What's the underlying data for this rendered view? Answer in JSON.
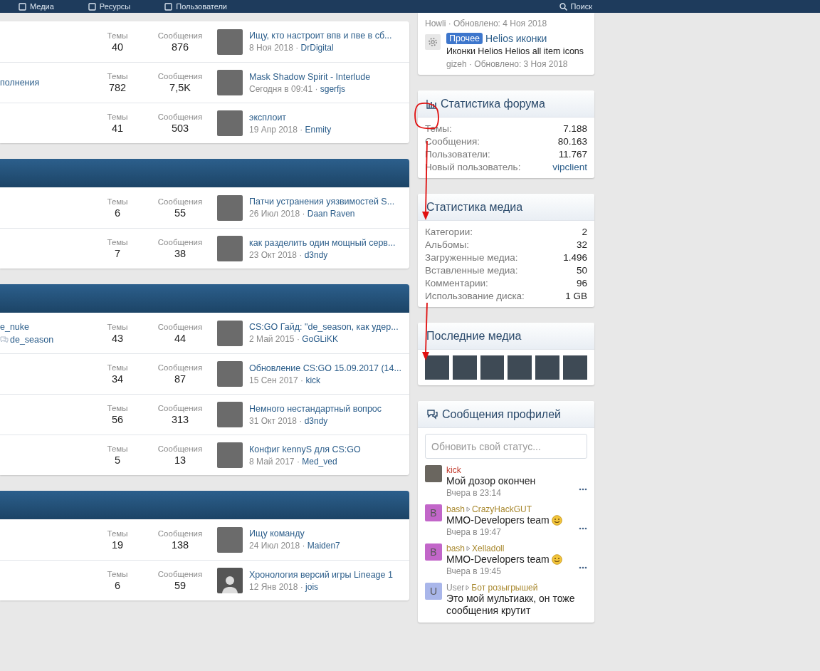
{
  "nav": {
    "items": [
      {
        "label": "Медиа"
      },
      {
        "label": "Ресурсы"
      },
      {
        "label": "Пользователи"
      }
    ],
    "search": "Поиск"
  },
  "sections": [
    {
      "header": false,
      "rows": [
        {
          "threads_label": "Темы",
          "threads": "40",
          "posts_label": "Сообщения",
          "posts": "876",
          "last_title": "Ищу, кто настроит впв и пве в сб...",
          "last_date": "8 Ноя 2018",
          "separator": "·",
          "last_user": "DrDigital",
          "default_avatar": false
        },
        {
          "fragment": "полнения",
          "threads_label": "Темы",
          "threads": "782",
          "posts_label": "Сообщения",
          "posts": "7,5K",
          "last_title": "Mask Shadow Spirit - Interlude",
          "last_date": "Сегодня в 09:41",
          "separator": "·",
          "last_user": "sgerfjs",
          "default_avatar": false
        },
        {
          "threads_label": "Темы",
          "threads": "41",
          "posts_label": "Сообщения",
          "posts": "503",
          "last_title": "эксплоит",
          "last_date": "19 Апр 2018",
          "separator": "·",
          "last_user": "Enmity",
          "default_avatar": false
        }
      ]
    },
    {
      "header": true,
      "rows": [
        {
          "threads_label": "Темы",
          "threads": "6",
          "posts_label": "Сообщения",
          "posts": "55",
          "last_title": "Патчи устранения уязвимостей S...",
          "last_date": "26 Июл 2018",
          "separator": "·",
          "last_user": "Daan Raven",
          "default_avatar": false
        },
        {
          "threads_label": "Темы",
          "threads": "7",
          "posts_label": "Сообщения",
          "posts": "38",
          "last_title": "как разделить один мощный серв...",
          "last_date": "23 Окт 2018",
          "separator": "·",
          "last_user": "d3ndy",
          "default_avatar": false
        }
      ]
    },
    {
      "header": true,
      "rows": [
        {
          "subforums": [
            {
              "label": "e_nuke",
              "icon": false
            },
            {
              "label": "de_season",
              "icon": true
            }
          ],
          "threads_label": "Темы",
          "threads": "43",
          "posts_label": "Сообщения",
          "posts": "44",
          "last_title": "CS:GO Гайд: \"de_season, как удер...",
          "last_date": "2 Май 2015",
          "separator": "·",
          "last_user": "GoGLiKK",
          "default_avatar": false
        },
        {
          "threads_label": "Темы",
          "threads": "34",
          "posts_label": "Сообщения",
          "posts": "87",
          "last_title": "Обновление CS:GO 15.09.2017 (14...",
          "last_date": "15 Сен 2017",
          "separator": "·",
          "last_user": "kick",
          "default_avatar": false
        },
        {
          "threads_label": "Темы",
          "threads": "56",
          "posts_label": "Сообщения",
          "posts": "313",
          "last_title": "Немного нестандартный вопрос",
          "last_date": "31 Окт 2018",
          "separator": "·",
          "last_user": "d3ndy",
          "default_avatar": false
        },
        {
          "threads_label": "Темы",
          "threads": "5",
          "posts_label": "Сообщения",
          "posts": "13",
          "last_title": "Конфиг kennyS для CS:GO",
          "last_date": "8 Май 2017",
          "separator": "·",
          "last_user": "Med_ved",
          "default_avatar": false
        }
      ]
    },
    {
      "header": true,
      "rows": [
        {
          "threads_label": "Темы",
          "threads": "19",
          "posts_label": "Сообщения",
          "posts": "138",
          "last_title": "Ищу команду",
          "last_date": "24 Июл 2018",
          "separator": "·",
          "last_user": "Maiden7",
          "default_avatar": false
        },
        {
          "threads_label": "Темы",
          "threads": "6",
          "posts_label": "Сообщения",
          "posts": "59",
          "last_title": "Хронология версий игры Lineage 1",
          "last_date": "12 Янв 2018",
          "separator": "·",
          "last_user": "jois",
          "default_avatar": true
        }
      ]
    }
  ],
  "resources": {
    "items": [
      {
        "meta": "Howli · Обновлено: 4 Ноя 2018"
      },
      {
        "badge": "Прочее",
        "title": "Helios иконки",
        "description": "Иконки Helios Helios all item icons",
        "meta": "gizeh · Обновлено: 3 Ноя 2018"
      }
    ]
  },
  "forum_stats": {
    "title": "Статистика форума",
    "rows": [
      {
        "label": "Темы:",
        "value": "7.188",
        "kind": "text"
      },
      {
        "label": "Сообщения:",
        "value": "80.163",
        "kind": "text"
      },
      {
        "label": "Пользователи:",
        "value": "11.767",
        "kind": "text"
      },
      {
        "label": "Новый пользователь:",
        "value": "vipclient",
        "kind": "link"
      }
    ]
  },
  "media_stats": {
    "title": "Статистика медиа",
    "rows": [
      {
        "label": "Категории:",
        "value": "2",
        "kind": "text"
      },
      {
        "label": "Альбомы:",
        "value": "32",
        "kind": "text"
      },
      {
        "label": "Загруженные медиа:",
        "value": "1.496",
        "kind": "text"
      },
      {
        "label": "Вставленные медиа:",
        "value": "50",
        "kind": "text"
      },
      {
        "label": "Комментарии:",
        "value": "96",
        "kind": "text"
      },
      {
        "label": "Использование диска:",
        "value": "1 GB",
        "kind": "text"
      }
    ]
  },
  "recent_media": {
    "title": "Последние медиа",
    "thumbnails": [
      {
        "kind": "photo"
      },
      {
        "kind": "photo"
      },
      {
        "kind": "photo"
      },
      {
        "kind": "photo"
      },
      {
        "kind": "photo"
      },
      {
        "kind": "photo"
      }
    ]
  },
  "profile_posts": {
    "title": "Сообщения профилей",
    "placeholder": "Обновить свой статус...",
    "posts": [
      {
        "author": {
          "name": "kick",
          "color": "#c0392b"
        },
        "text": "Мой дозор окончен",
        "smiley": false,
        "time": "Вчера в 23:14"
      },
      {
        "avatar": {
          "letter": "B",
          "color": "#c266c9"
        },
        "author": {
          "name": "bash",
          "color": "#a8882e"
        },
        "target": {
          "name": "CrazyHackGUT",
          "color": "#a8882e"
        },
        "text": "MMO-Developers team",
        "smiley": true,
        "time": "Вчера в 19:47"
      },
      {
        "avatar": {
          "letter": "B",
          "color": "#c266c9"
        },
        "author": {
          "name": "bash",
          "color": "#a8882e"
        },
        "target": {
          "name": "Xelladoll",
          "color": "#a8882e"
        },
        "text": "MMO-Developers team",
        "smiley": true,
        "time": "Вчера в 19:45"
      },
      {
        "avatar": {
          "letter": "U",
          "color": "#a9b6ea"
        },
        "author": {
          "name": "User",
          "color": "#8a8a8a"
        },
        "target": {
          "name": "Бот розыгрышей",
          "color": "#a8882e"
        },
        "text": "Это мой мультиакк, он тоже сообщения крутит",
        "smiley": false
      }
    ]
  }
}
